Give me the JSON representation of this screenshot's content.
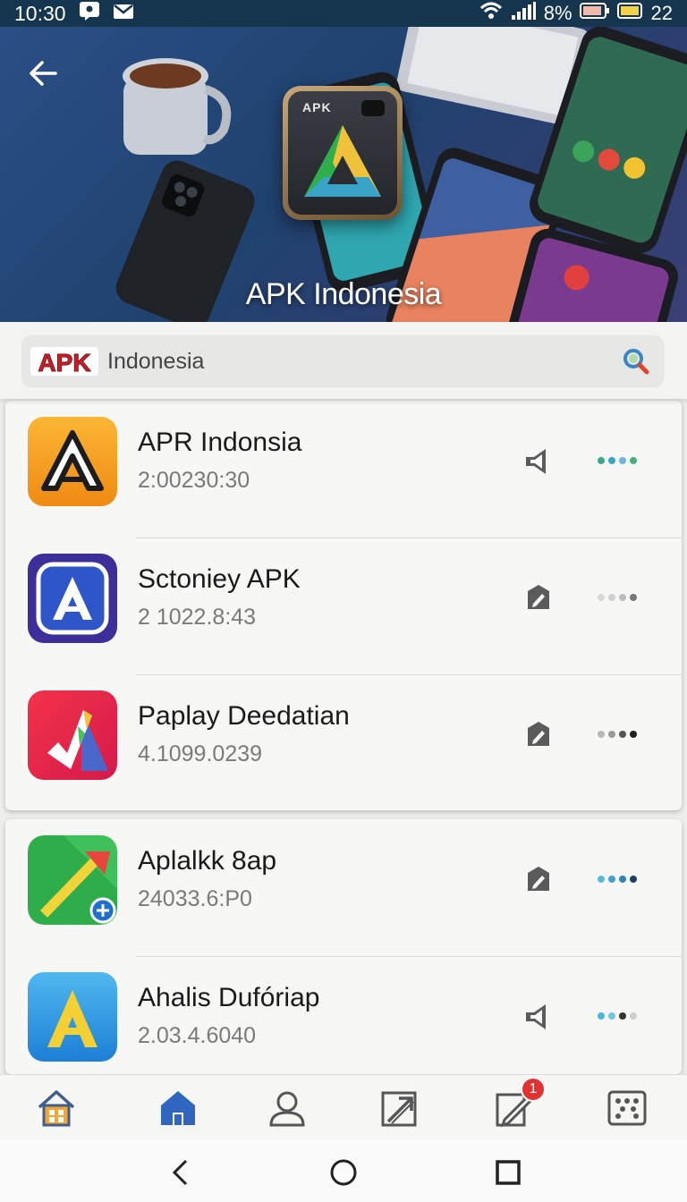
{
  "status_bar": {
    "time": "10:30",
    "battery_percent": "8%",
    "extra": "22",
    "icons": [
      "message-icon",
      "mail-icon",
      "wifi-icon",
      "signal-icon",
      "battery-icon",
      "battery-icon-2"
    ]
  },
  "hero": {
    "title": "APK Indonesia",
    "icon_label": "APK"
  },
  "search": {
    "logo_text": "APK",
    "value": "Indonesia",
    "placeholder": "Indonesia"
  },
  "apps": [
    {
      "name": "APR Indonsia",
      "meta": "2:00230:30",
      "action_icon": "volume-icon",
      "dots": [
        "#3aa88a",
        "#36a2c7",
        "#6bb6e3",
        "#44b080"
      ]
    },
    {
      "name": "Sctoniey APK",
      "meta": "2 1022.8:43",
      "action_icon": "edit-icon",
      "dots": [
        "#d8d8d8",
        "#cfcfcf",
        "#bdbdbd",
        "#777777"
      ]
    },
    {
      "name": "Paplay Deedatian",
      "meta": "4.1099.0239",
      "action_icon": "edit-icon",
      "dots": [
        "#b8b8b8",
        "#9a9a9a",
        "#555555",
        "#222222"
      ]
    },
    {
      "name": "Aplalkk 8ap",
      "meta": "24033.6:P0",
      "action_icon": "edit-icon",
      "dots": [
        "#59b9d8",
        "#3da4cf",
        "#2e86b8",
        "#1c3f66"
      ]
    },
    {
      "name": "Ahalis Dufóriap",
      "meta": "2.03.4.6040",
      "action_icon": "volume-icon",
      "dots": [
        "#4ab8d8",
        "#6fc7e1",
        "#333333",
        "#cfcfcf"
      ]
    }
  ],
  "bottom_nav": {
    "badge": "1",
    "items": [
      "home-icon",
      "store-icon",
      "profile-icon",
      "share-icon",
      "edit-notifications-icon",
      "dice-icon"
    ]
  },
  "colors": {
    "accent": "#3066c0",
    "badge": "#e23131",
    "status_bar": "#16354f"
  }
}
